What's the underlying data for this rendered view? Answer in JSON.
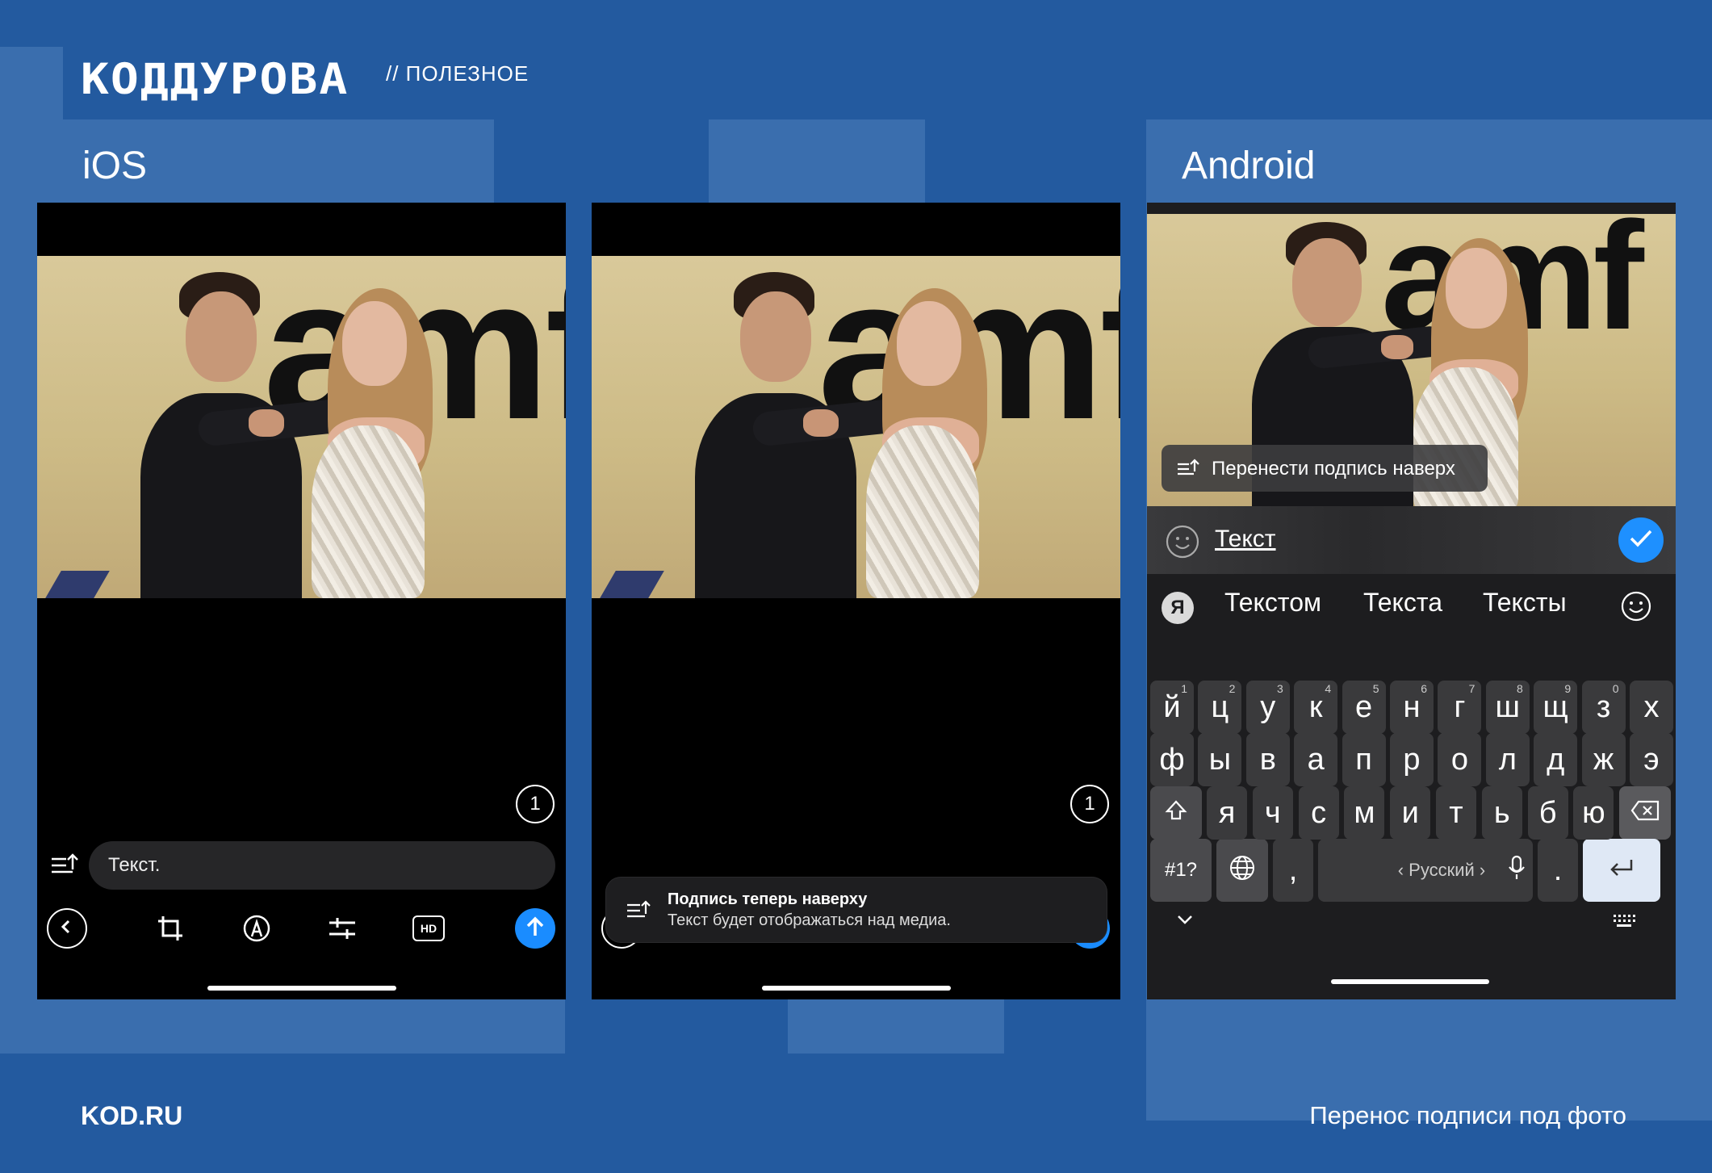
{
  "header": {
    "logo": "КОДДУРОВА",
    "section": "// ПОЛЕЗНОЕ"
  },
  "labels": {
    "ios": "iOS",
    "android": "Android"
  },
  "footer": {
    "site": "KOD.RU",
    "caption": "Перенос подписи под фото"
  },
  "photo": {
    "sign_text": "amf"
  },
  "ios_phone_1": {
    "counter": "1",
    "caption_input": "Текст.",
    "toolbar_icons": [
      "back-icon",
      "crop-icon",
      "draw-icon",
      "adjust-icon",
      "hd-icon",
      "send-icon"
    ],
    "hd_label": "HD"
  },
  "ios_phone_2": {
    "counter": "1",
    "toast_title": "Подпись теперь наверху",
    "toast_body": "Текст будет отображаться над медиа."
  },
  "android_phone": {
    "move_caption_button": "Перенести подпись наверх",
    "caption_text": "Текст",
    "suggestions": [
      "Текстом",
      "Текста",
      "Тексты"
    ],
    "keyboard_logo": "Я",
    "rows": [
      [
        [
          "й",
          "1"
        ],
        [
          "ц",
          "2"
        ],
        [
          "у",
          "3"
        ],
        [
          "к",
          "4"
        ],
        [
          "е",
          "5"
        ],
        [
          "н",
          "6"
        ],
        [
          "г",
          "7"
        ],
        [
          "ш",
          "8"
        ],
        [
          "щ",
          "9"
        ],
        [
          "з",
          "0"
        ],
        [
          "х",
          ""
        ]
      ],
      [
        [
          "ф",
          ""
        ],
        [
          "ы",
          ""
        ],
        [
          "в",
          ""
        ],
        [
          "а",
          ""
        ],
        [
          "п",
          ""
        ],
        [
          "р",
          ""
        ],
        [
          "о",
          ""
        ],
        [
          "л",
          ""
        ],
        [
          "д",
          ""
        ],
        [
          "ж",
          ""
        ],
        [
          "э",
          ""
        ]
      ],
      [
        [
          "я",
          ""
        ],
        [
          "ч",
          ""
        ],
        [
          "с",
          ""
        ],
        [
          "м",
          ""
        ],
        [
          "и",
          ""
        ],
        [
          "т",
          ""
        ],
        [
          "ь",
          ""
        ],
        [
          "б",
          ""
        ],
        [
          "ю",
          ""
        ]
      ]
    ],
    "symbols_key": "#1?",
    "comma_key": ",",
    "period_key": ".",
    "space_label": "‹ Русский ›"
  },
  "colors": {
    "background": "#235a9f",
    "accent": "#1e90ff",
    "ios_send": "#1a8cff"
  }
}
